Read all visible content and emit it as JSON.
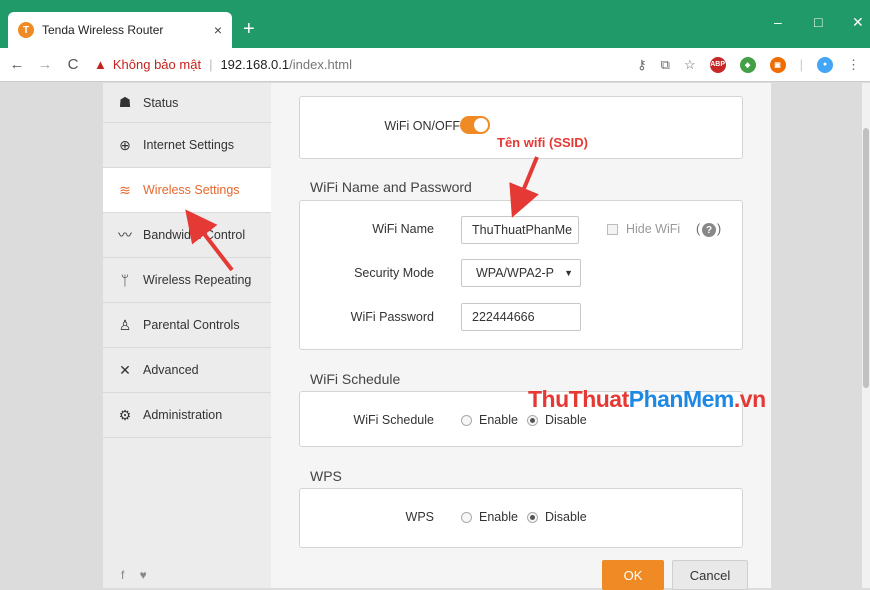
{
  "browser": {
    "tab_title": "Tenda Wireless Router",
    "tab_close": "×",
    "new_tab": "+",
    "window_controls": {
      "minimize": "–",
      "maximize": "□",
      "close": "✕"
    },
    "nav": {
      "back": "←",
      "forward": "→",
      "reload": "C"
    },
    "security_warning": "Không bảo mật",
    "url_host": "192.168.0.1",
    "url_path": "/index.html",
    "extensions": [
      "key-icon",
      "translate-icon",
      "star-icon",
      "adblock-icon",
      "extension-icon",
      "extension-icon-2",
      "profile-icon",
      "menu-icon"
    ]
  },
  "sidebar": {
    "items": [
      {
        "label": "Status",
        "icon": "router-icon"
      },
      {
        "label": "Internet Settings",
        "icon": "globe-icon"
      },
      {
        "label": "Wireless Settings",
        "icon": "wifi-icon",
        "active": true
      },
      {
        "label": "Bandwidth Control",
        "icon": "bandwidth-icon"
      },
      {
        "label": "Wireless Repeating",
        "icon": "antenna-icon"
      },
      {
        "label": "Parental Controls",
        "icon": "family-icon"
      },
      {
        "label": "Advanced",
        "icon": "tools-icon"
      },
      {
        "label": "Administration",
        "icon": "gears-icon"
      }
    ],
    "social": "f ♥"
  },
  "wifi_toggle": {
    "label": "WiFi ON/OFF",
    "on": true
  },
  "name_password": {
    "title": "WiFi Name and Password",
    "wifi_name_label": "WiFi Name",
    "wifi_name_value": "ThuThuatPhanMe",
    "hide_wifi_label": "Hide WiFi",
    "hide_wifi_checked": false,
    "help_symbol": "?",
    "security_mode_label": "Security Mode",
    "security_mode_value": "WPA/WPA2-P",
    "wifi_password_label": "WiFi Password",
    "wifi_password_value": "222444666"
  },
  "schedule": {
    "title": "WiFi Schedule",
    "label": "WiFi Schedule",
    "enable": "Enable",
    "disable": "Disable",
    "selected": "Disable"
  },
  "wps": {
    "title": "WPS",
    "label": "WPS",
    "enable": "Enable",
    "disable": "Disable",
    "selected": "Disable"
  },
  "buttons": {
    "ok": "OK",
    "cancel": "Cancel"
  },
  "annotation": {
    "ssid_label": "Tên wifi (SSID)"
  },
  "watermark": {
    "part1": "ThuThuat",
    "part2": "PhanMem",
    "part3": ".vn"
  },
  "colors": {
    "accent": "#f08a24",
    "titlebar": "#1f9a68",
    "annotation": "#e53935",
    "active_nav": "#e5682e"
  }
}
